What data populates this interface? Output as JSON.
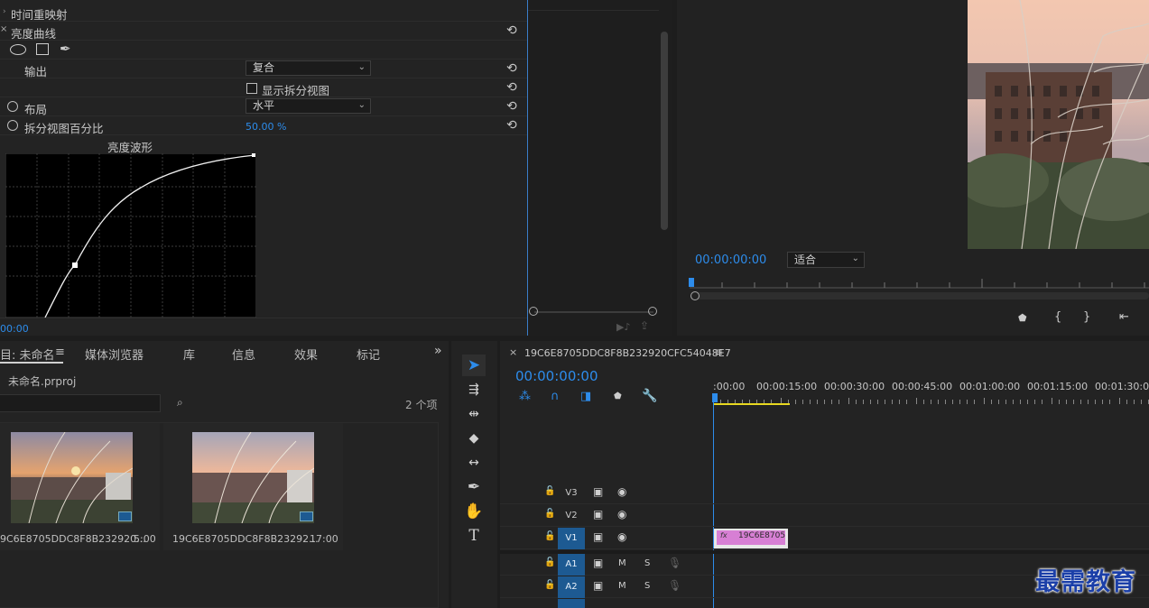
{
  "effect_controls": {
    "time_remap_label": "时间重映射",
    "luma_curve_label": "亮度曲线",
    "output_label": "输出",
    "output_value": "复合",
    "show_split_label": "显示拆分视图",
    "layout_label": "布局",
    "layout_value": "水平",
    "split_percent_label": "拆分视图百分比",
    "split_percent_value": "50.00 %",
    "waveform_label": "亮度波形",
    "timecode": "00:00"
  },
  "program_monitor": {
    "timecode": "00:00:00:00",
    "fit_value": "适合"
  },
  "project": {
    "tabs": [
      "目: 未命名",
      "媒体浏览器",
      "库",
      "信息",
      "效果",
      "标记"
    ],
    "overflow": "»",
    "file_name": "未命名.prproj",
    "item_count": "2 个项",
    "items": [
      {
        "name": "9C6E8705DDC8F8B232920...",
        "duration": "5:00"
      },
      {
        "name": "19C6E8705DDC8F8B23292...",
        "duration": "17:00"
      }
    ]
  },
  "timeline": {
    "sequence_name": "19C6E8705DDC8F8B232920CFC54048E7",
    "timecode": "00:00:00:00",
    "ruler": [
      ":00:00",
      "00:00:15:00",
      "00:00:30:00",
      "00:00:45:00",
      "00:01:00:00",
      "00:01:15:00",
      "00:01:30:00"
    ],
    "tracks": [
      {
        "name": "V3",
        "active": false
      },
      {
        "name": "V2",
        "active": false
      },
      {
        "name": "V1",
        "active": true
      },
      {
        "name": "A1",
        "active": true
      },
      {
        "name": "A2",
        "active": true
      }
    ],
    "clip_label": "19C6E8705",
    "fx_badge": "fx",
    "m_label": "M",
    "s_label": "S"
  },
  "watermark": "最需教育",
  "colors": {
    "accent": "#2d8ceb",
    "track_active": "#1d5a92",
    "clip": "#d77fd4",
    "work_area": "#e8d820"
  }
}
